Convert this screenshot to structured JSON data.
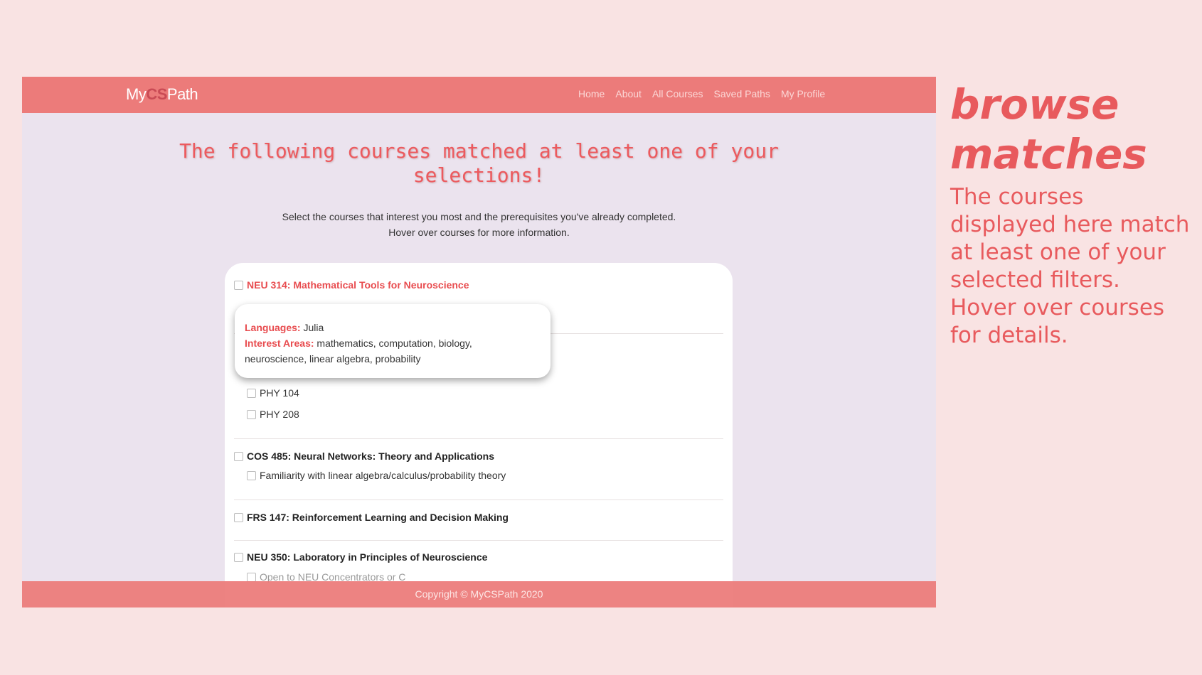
{
  "navbar": {
    "logo_prefix": "My",
    "logo_cs": "CS",
    "logo_suffix": "Path",
    "links": [
      "Home",
      "About",
      "All Courses",
      "Saved Paths",
      "My Profile"
    ]
  },
  "headline": {
    "line1": "The following courses matched at least one of your",
    "line2": "selections!"
  },
  "instructions": {
    "line1": "Select the courses that interest you most and the prerequisites you've already completed.",
    "line2": "Hover over courses for more information."
  },
  "courses": [
    {
      "title": "NEU 314: Mathematical Tools for Neuroscience",
      "prereqs": [
        "PHY 104",
        "PHY 208"
      ]
    },
    {
      "title": "COS 485: Neural Networks: Theory and Applications",
      "prereqs": [
        "Familiarity with linear algebra/calculus/probability theory"
      ]
    },
    {
      "title": "FRS 147: Reinforcement Learning and Decision Making",
      "prereqs": []
    },
    {
      "title": "NEU 350: Laboratory in Principles of Neuroscience",
      "prereqs": [
        "Open to NEU Concentrators or C"
      ]
    }
  ],
  "tooltip": {
    "languages_label": "Languages:",
    "languages_value": "Julia",
    "interest_label": "Interest Areas:",
    "interest_value": "mathematics, computation, biology,",
    "interest_value_2": "neuroscience, linear algebra, probability"
  },
  "footer": {
    "copyright": "Copyright © MyCSPath 2020"
  },
  "side_panel": {
    "title_line1": "browse",
    "title_line2": "matches",
    "description": "The courses displayed here match at least one of your selected filters. Hover over courses for details."
  },
  "colors": {
    "accent": "#ec7b7a",
    "title_red": "#e84c4f",
    "page_bg": "#f9e3e3",
    "content_bg": "#ebe3ee"
  }
}
